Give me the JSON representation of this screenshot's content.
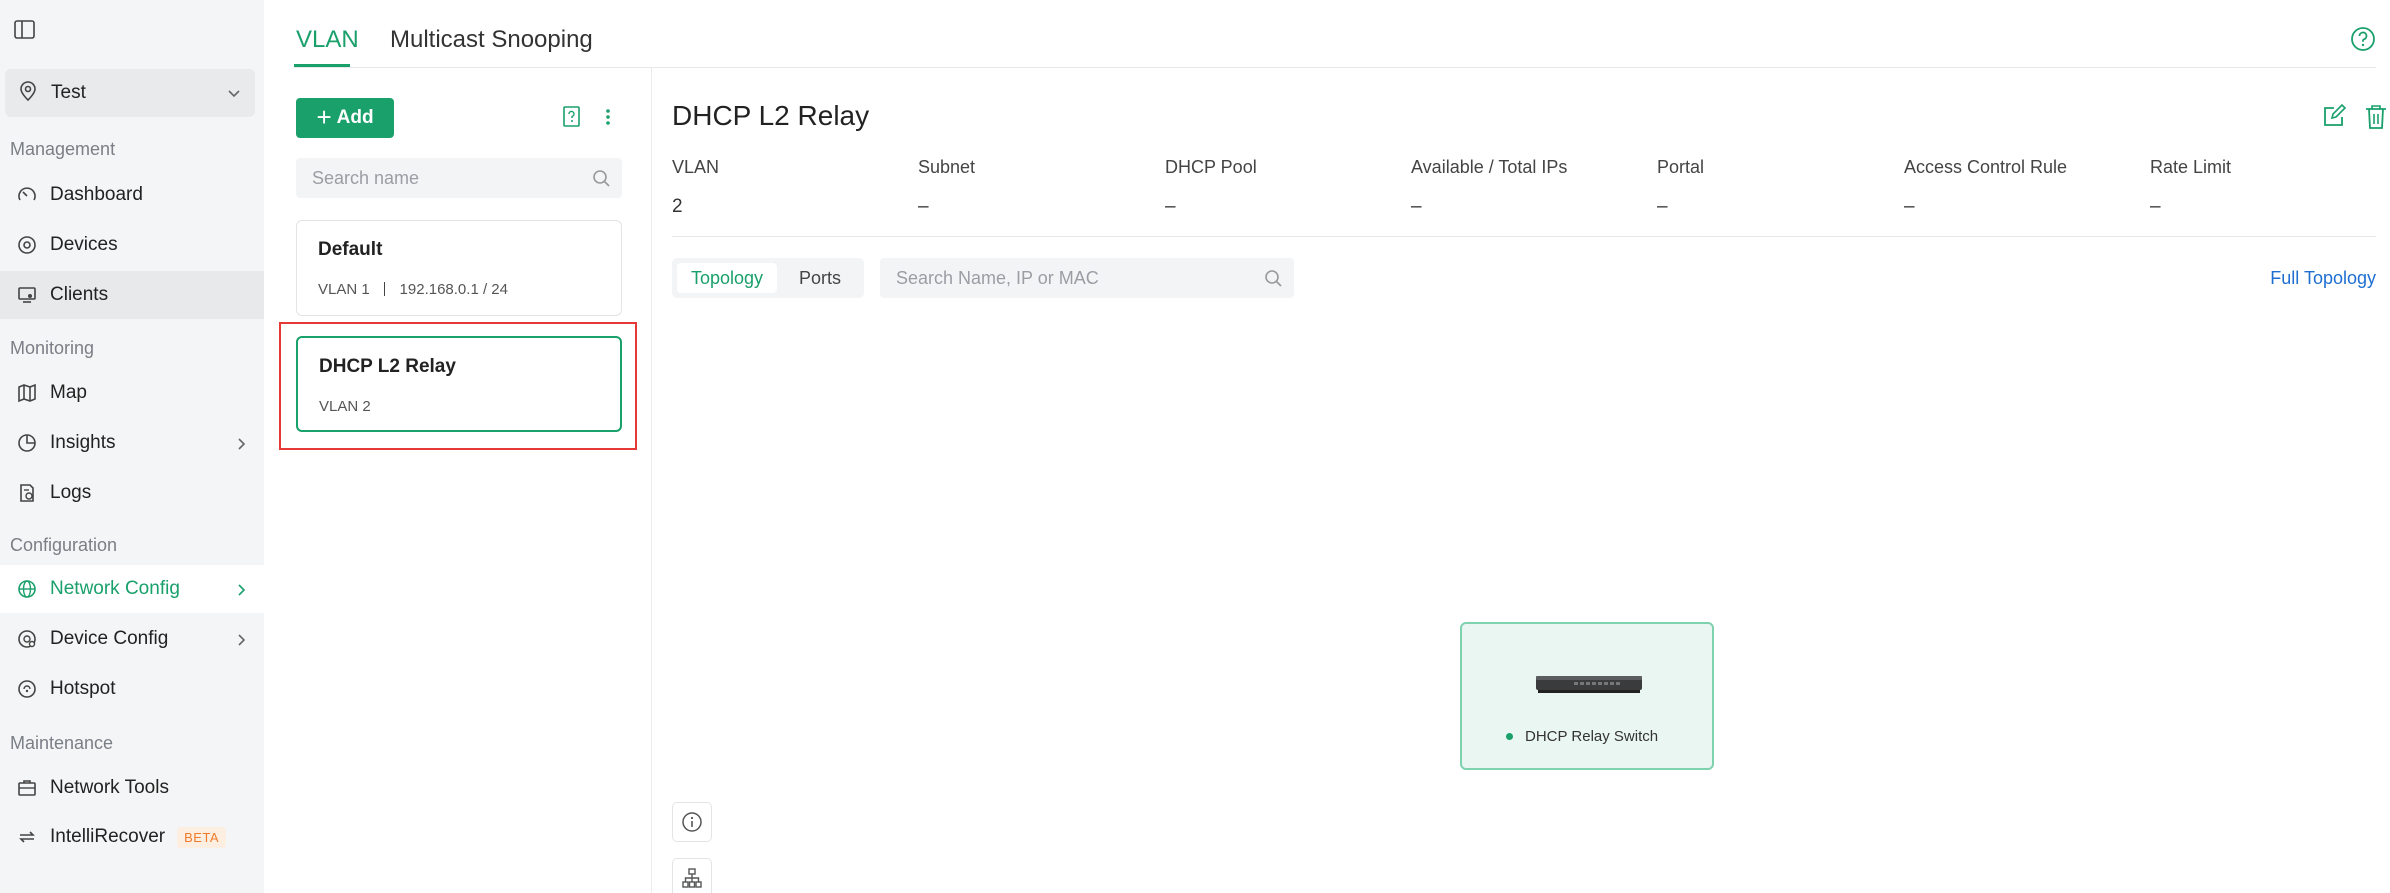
{
  "sidebar": {
    "site": "Test",
    "sections": {
      "management": "Management",
      "monitoring": "Monitoring",
      "configuration": "Configuration",
      "maintenance": "Maintenance"
    },
    "items": {
      "dashboard": "Dashboard",
      "devices": "Devices",
      "clients": "Clients",
      "map": "Map",
      "insights": "Insights",
      "logs": "Logs",
      "network_config": "Network Config",
      "device_config": "Device Config",
      "hotspot": "Hotspot",
      "network_tools": "Network Tools",
      "intellirecover": "IntelliRecover"
    },
    "beta_badge": "BETA"
  },
  "tabs": {
    "vlan": "VLAN",
    "multicast": "Multicast Snooping"
  },
  "list": {
    "add_label": "Add",
    "search_placeholder": "Search name",
    "vlans": [
      {
        "name": "Default",
        "vlan": "VLAN 1",
        "subnet": "192.168.0.1 / 24"
      },
      {
        "name": "DHCP L2 Relay",
        "vlan": "VLAN 2"
      }
    ]
  },
  "detail": {
    "title": "DHCP L2 Relay",
    "fields": [
      {
        "label": "VLAN",
        "value": "2"
      },
      {
        "label": "Subnet",
        "value": "–"
      },
      {
        "label": "DHCP Pool",
        "value": "–"
      },
      {
        "label": "Available / Total IPs",
        "value": "–"
      },
      {
        "label": "Portal",
        "value": "–"
      },
      {
        "label": "Access Control Rule",
        "value": "–"
      },
      {
        "label": "Rate Limit",
        "value": "–"
      }
    ],
    "view_tabs": {
      "topology": "Topology",
      "ports": "Ports"
    },
    "search_placeholder": "Search Name, IP or MAC",
    "full_topology": "Full Topology",
    "node_label": "DHCP Relay Switch"
  },
  "colors": {
    "accent": "#1aa06b",
    "link": "#1f6fd1",
    "highlight": "#e53935",
    "beta": "#f07c2a"
  }
}
